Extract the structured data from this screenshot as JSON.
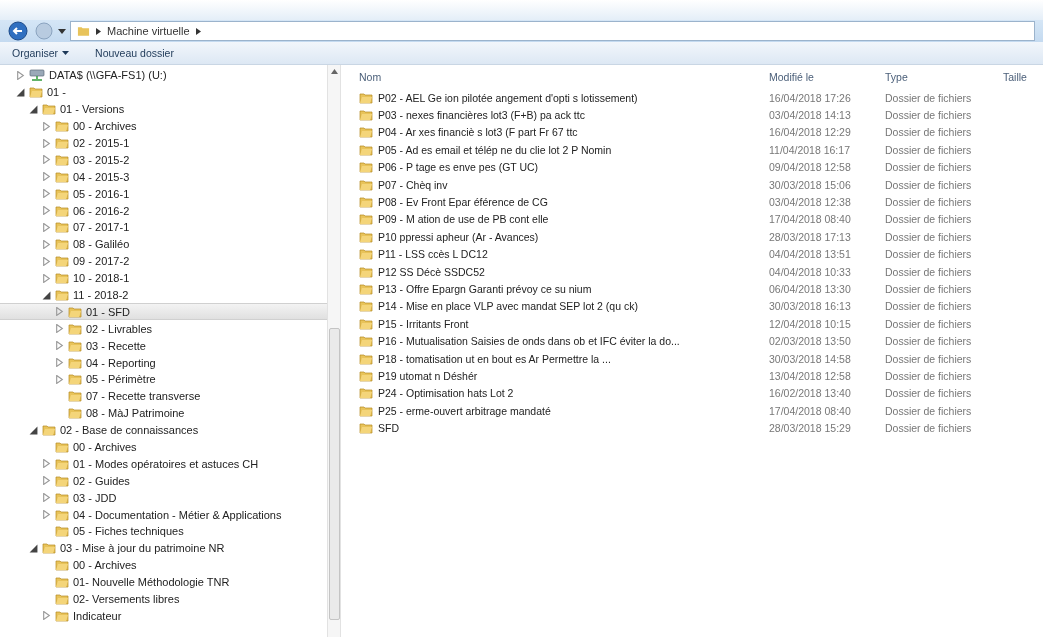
{
  "address_bar": {
    "segments": [
      "Machine virtuelle"
    ]
  },
  "toolbar": {
    "buttons": [
      {
        "label": "Organiser",
        "dropdown": true
      },
      {
        "label": "Nouveau dossier",
        "dropdown": false
      }
    ]
  },
  "tree": [
    {
      "label": "DATA$ (\\\\GFA-FS1) (U:)",
      "kind": "drive",
      "expandable": true,
      "expanded": false,
      "selected": false
    },
    {
      "label": "01 -",
      "kind": "folder",
      "expandable": true,
      "expanded": true,
      "selected": false,
      "children": [
        {
          "label": "01 - Versions",
          "kind": "folder",
          "expandable": true,
          "expanded": true,
          "selected": false,
          "children": [
            {
              "label": "00 - Archives",
              "kind": "folder",
              "expandable": true,
              "expanded": false,
              "selected": false
            },
            {
              "label": "02 - 2015-1",
              "kind": "folder",
              "expandable": true,
              "expanded": false,
              "selected": false
            },
            {
              "label": "03 - 2015-2",
              "kind": "folder",
              "expandable": true,
              "expanded": false,
              "selected": false
            },
            {
              "label": "04 - 2015-3",
              "kind": "folder",
              "expandable": true,
              "expanded": false,
              "selected": false
            },
            {
              "label": "05 - 2016-1",
              "kind": "folder",
              "expandable": true,
              "expanded": false,
              "selected": false
            },
            {
              "label": "06 - 2016-2",
              "kind": "folder",
              "expandable": true,
              "expanded": false,
              "selected": false
            },
            {
              "label": "07 - 2017-1",
              "kind": "folder",
              "expandable": true,
              "expanded": false,
              "selected": false
            },
            {
              "label": "08 - Galiléo",
              "kind": "folder",
              "expandable": true,
              "expanded": false,
              "selected": false
            },
            {
              "label": "09 - 2017-2",
              "kind": "folder",
              "expandable": true,
              "expanded": false,
              "selected": false
            },
            {
              "label": "10 - 2018-1",
              "kind": "folder",
              "expandable": true,
              "expanded": false,
              "selected": false
            },
            {
              "label": "11 - 2018-2",
              "kind": "folder",
              "expandable": true,
              "expanded": true,
              "selected": false,
              "children": [
                {
                  "label": "01 - SFD",
                  "kind": "folder",
                  "expandable": true,
                  "expanded": false,
                  "selected": true
                },
                {
                  "label": "02 - Livrables",
                  "kind": "folder",
                  "expandable": true,
                  "expanded": false,
                  "selected": false
                },
                {
                  "label": "03 - Recette",
                  "kind": "folder",
                  "expandable": true,
                  "expanded": false,
                  "selected": false
                },
                {
                  "label": "04 - Reporting",
                  "kind": "folder",
                  "expandable": true,
                  "expanded": false,
                  "selected": false
                },
                {
                  "label": "05 - Périmètre",
                  "kind": "folder",
                  "expandable": true,
                  "expanded": false,
                  "selected": false
                },
                {
                  "label": "07 - Recette transverse",
                  "kind": "folder",
                  "expandable": false,
                  "selected": false
                },
                {
                  "label": "08 - MàJ Patrimoine",
                  "kind": "folder",
                  "expandable": false,
                  "selected": false
                }
              ]
            }
          ]
        },
        {
          "label": "02 - Base de connaissances",
          "kind": "folder",
          "expandable": true,
          "expanded": true,
          "selected": false,
          "children": [
            {
              "label": "00 - Archives",
              "kind": "folder",
              "expandable": false,
              "selected": false
            },
            {
              "label": "01 - Modes opératoires et astuces CH",
              "kind": "folder",
              "expandable": true,
              "expanded": false,
              "selected": false
            },
            {
              "label": "02 - Guides",
              "kind": "folder",
              "expandable": true,
              "expanded": false,
              "selected": false
            },
            {
              "label": "03 - JDD",
              "kind": "folder",
              "expandable": true,
              "expanded": false,
              "selected": false
            },
            {
              "label": "04 - Documentation - Métier & Applications",
              "kind": "folder",
              "expandable": true,
              "expanded": false,
              "selected": false
            },
            {
              "label": "05 - Fiches techniques",
              "kind": "folder",
              "expandable": false,
              "selected": false
            }
          ]
        },
        {
          "label": "03 - Mise à jour du patrimoine NR",
          "kind": "folder",
          "expandable": true,
          "expanded": true,
          "selected": false,
          "children": [
            {
              "label": "00 - Archives",
              "kind": "folder",
              "expandable": false,
              "selected": false
            },
            {
              "label": "01- Nouvelle Méthodologie TNR",
              "kind": "folder",
              "expandable": false,
              "selected": false
            },
            {
              "label": "02- Versements libres",
              "kind": "folder",
              "expandable": false,
              "selected": false
            },
            {
              "label": "Indicateur",
              "kind": "folder",
              "expandable": true,
              "expanded": false,
              "selected": false
            }
          ]
        }
      ]
    }
  ],
  "file_list": {
    "columns": [
      "Nom",
      "Modifié le",
      "Type",
      "Taille"
    ],
    "rows": [
      {
        "name": "P02 - AEL Ge ion pilotée angement d'opti s lotissement)",
        "modified": "16/04/2018 17:26",
        "type": "Dossier de fichiers"
      },
      {
        "name": "P03 - nexes financières lot3 (F+B) pa ack ttc",
        "modified": "03/04/2018 14:13",
        "type": "Dossier de fichiers"
      },
      {
        "name": "P04 - Ar xes financiè s lot3 (F part Fr 67 ttc",
        "modified": "16/04/2018 12:29",
        "type": "Dossier de fichiers"
      },
      {
        "name": "P05 - Ad es email et télép ne du clie lot 2 P Nomin",
        "modified": "11/04/2018 16:17",
        "type": "Dossier de fichiers"
      },
      {
        "name": "P06 - P tage es enve pes (GT UC)",
        "modified": "09/04/2018 12:58",
        "type": "Dossier de fichiers"
      },
      {
        "name": "P07 - Chèq inv",
        "modified": "30/03/2018 15:06",
        "type": "Dossier de fichiers"
      },
      {
        "name": "P08 - Ev Front Epar éférence de CG",
        "modified": "03/04/2018 12:38",
        "type": "Dossier de fichiers"
      },
      {
        "name": "P09 - M ation de use de PB cont elle",
        "modified": "17/04/2018 08:40",
        "type": "Dossier de fichiers"
      },
      {
        "name": "P10 ppressi apheur (Ar - Avances)",
        "modified": "28/03/2018 17:13",
        "type": "Dossier de fichiers"
      },
      {
        "name": "P11 - LSS ccès L DC12",
        "modified": "04/04/2018 13:51",
        "type": "Dossier de fichiers"
      },
      {
        "name": "P12 SS Décè SSDC52",
        "modified": "04/04/2018 10:33",
        "type": "Dossier de fichiers"
      },
      {
        "name": "P13 - Offre Epargn Garanti prévoy ce su nium",
        "modified": "06/04/2018 13:30",
        "type": "Dossier de fichiers"
      },
      {
        "name": "P14 - Mise en place VLP avec mandat SEP lot 2 (qu ck)",
        "modified": "30/03/2018 16:13",
        "type": "Dossier de fichiers"
      },
      {
        "name": "P15 - Irritants Front",
        "modified": "12/04/2018 10:15",
        "type": "Dossier de fichiers"
      },
      {
        "name": "P16 - Mutualisation Saisies de onds dans ob et IFC éviter la do...",
        "modified": "02/03/2018 13:50",
        "type": "Dossier de fichiers"
      },
      {
        "name": "P18 - tomatisation ut en bout es Ar Permettre la ...",
        "modified": "30/03/2018 14:58",
        "type": "Dossier de fichiers"
      },
      {
        "name": "P19 utomat n Déshér",
        "modified": "13/04/2018 12:58",
        "type": "Dossier de fichiers"
      },
      {
        "name": "P24 - Optimisation hats Lot 2",
        "modified": "16/02/2018 13:40",
        "type": "Dossier de fichiers"
      },
      {
        "name": "P25 - erme-ouvert arbitrage mandaté",
        "modified": "17/04/2018 08:40",
        "type": "Dossier de fichiers"
      },
      {
        "name": "SFD",
        "modified": "28/03/2018 15:29",
        "type": "Dossier de fichiers"
      }
    ]
  }
}
